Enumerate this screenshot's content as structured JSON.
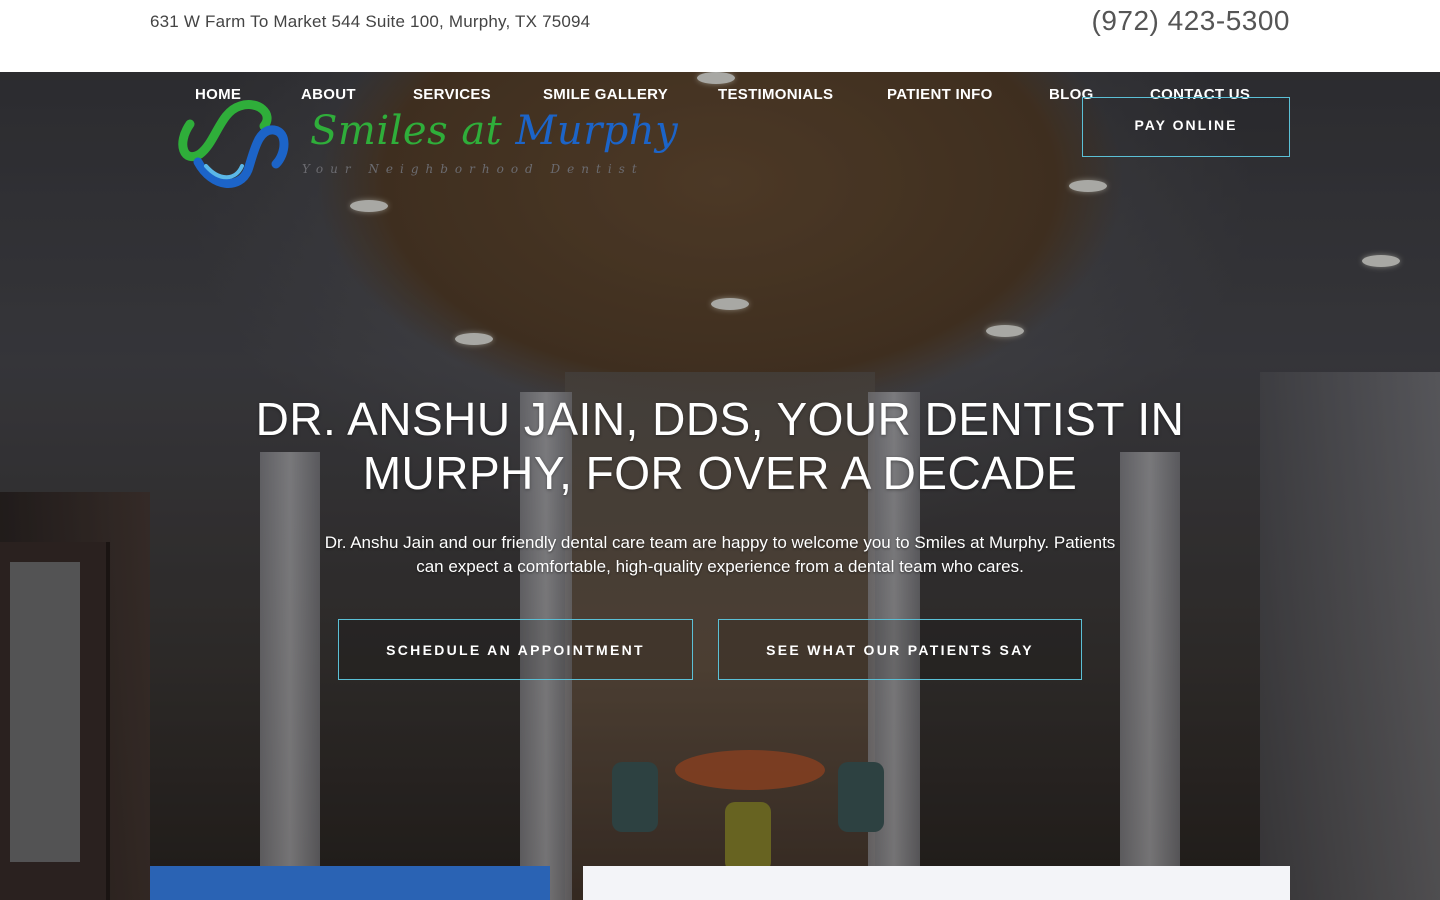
{
  "header": {
    "address": "631 W Farm To Market 544 Suite 100, Murphy, TX 75094",
    "phone": "(972) 423-5300"
  },
  "nav": {
    "items": [
      {
        "label": "HOME"
      },
      {
        "label": "ABOUT"
      },
      {
        "label": "SERVICES"
      },
      {
        "label": "SMILE GALLERY"
      },
      {
        "label": "TESTIMONIALS"
      },
      {
        "label": "PATIENT INFO"
      },
      {
        "label": "BLOG"
      },
      {
        "label": "CONTACT US"
      }
    ],
    "pay_button": "PAY ONLINE"
  },
  "logo": {
    "name_part1": "Smiles at ",
    "name_part2": "Murphy",
    "tagline": "Your Neighborhood Dentist"
  },
  "hero": {
    "headline_line1": "DR. ANSHU JAIN, DDS, YOUR DENTIST IN",
    "headline_line2": "MURPHY, FOR OVER A DECADE",
    "intro_line1": "Dr. Anshu Jain and our friendly dental care team are happy to welcome you to Smiles at Murphy. Patients",
    "intro_line2": "can expect a comfortable, high-quality experience from a dental team who cares.",
    "cta_primary": "SCHEDULE AN APPOINTMENT",
    "cta_secondary": "SEE WHAT OUR PATIENTS SAY"
  },
  "colors": {
    "accent_border": "#5bc0d6",
    "logo_green": "#2fae3a",
    "logo_blue": "#1c64c8",
    "card_blue": "#2a63b4"
  }
}
